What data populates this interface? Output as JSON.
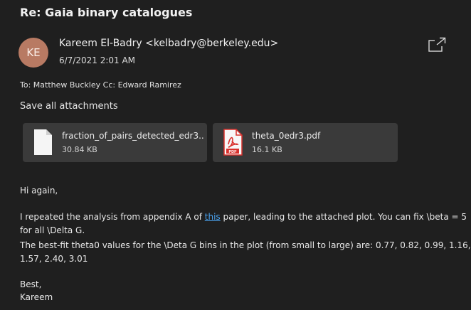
{
  "email": {
    "subject": "Re: Gaia binary catalogues",
    "sender": {
      "initials": "KE",
      "display": "Kareem El-Badry <kelbadry@berkeley.edu>",
      "date": "6/7/2021 2:01 AM",
      "avatar_color": "#b87a63"
    },
    "recipients": "To: Matthew Buckley Cc: Edward Ramirez",
    "popout_icon": "popout-window-icon"
  },
  "attachments": {
    "save_all_label": "Save all attachments",
    "items": [
      {
        "name": "fraction_of_pairs_detected_edr3....",
        "size": "30.84 KB",
        "icon": "file-icon"
      },
      {
        "name": "theta_0edr3.pdf",
        "size": "16.1 KB",
        "icon": "pdf-icon"
      }
    ]
  },
  "body": {
    "greeting": "Hi again,",
    "p1_before": "I repeated the analysis from appendix A of ",
    "p1_link": "this",
    "p1_after": " paper, leading to the attached plot. You can fix \\beta = 5",
    "p1_line2": "for all \\Delta G.",
    "p2_line1": "The best-fit theta0 values for the \\Deta G bins in the plot (from small to large) are: 0.77, 0.82, 0.99, 1.16,",
    "p2_line2": "1.57, 2.40, 3.01",
    "closing": "Best,",
    "signature": "Kareem"
  },
  "colors": {
    "background": "#1f1f1f",
    "card": "#3a3a3a",
    "link": "#4aa3f0",
    "pdf_red": "#d9302c"
  }
}
